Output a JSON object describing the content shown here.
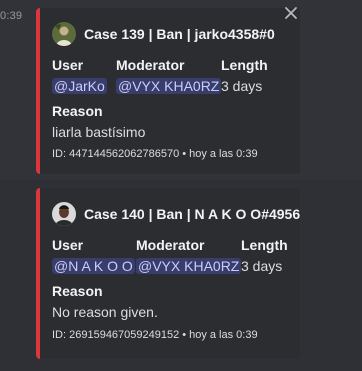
{
  "messages": [
    {
      "timestamp": "0:39",
      "embed": {
        "title": "Case 139 | Ban | jarko4358#0",
        "fields": {
          "user_label": "User",
          "user_value": "@JarKo",
          "moderator_label": "Moderator",
          "moderator_value": "@VYX KHA0RZ",
          "length_label": "Length",
          "length_value": "3 days",
          "reason_label": "Reason",
          "reason_value": "liarla bastísimo"
        },
        "footer": {
          "id": "ID: 447144562062786570",
          "separator": "•",
          "time": "hoy a las 0:39"
        },
        "accent_color": "#da373c"
      }
    },
    {
      "embed": {
        "title": "Case 140 | Ban | N A K O O#4956",
        "fields": {
          "user_label": "User",
          "user_value": "@N A K O O",
          "moderator_label": "Moderator",
          "moderator_value": "@VYX KHA0RZ",
          "length_label": "Length",
          "length_value": "3 days",
          "reason_label": "Reason",
          "reason_value": "No reason given."
        },
        "footer": {
          "id": "ID: 269159467059249152",
          "separator": "•",
          "time": "hoy a las 0:39"
        },
        "accent_color": "#da373c"
      }
    }
  ],
  "icons": {
    "close": "close-icon",
    "avatar_1": "user-avatar-icon",
    "avatar_2": "user-avatar-icon"
  },
  "colors": {
    "background": "#313338",
    "hover_background": "#2e3035",
    "embed_background": "#2b2d31",
    "mention_text": "#c9cdfb",
    "muted_text": "#949ba4"
  }
}
